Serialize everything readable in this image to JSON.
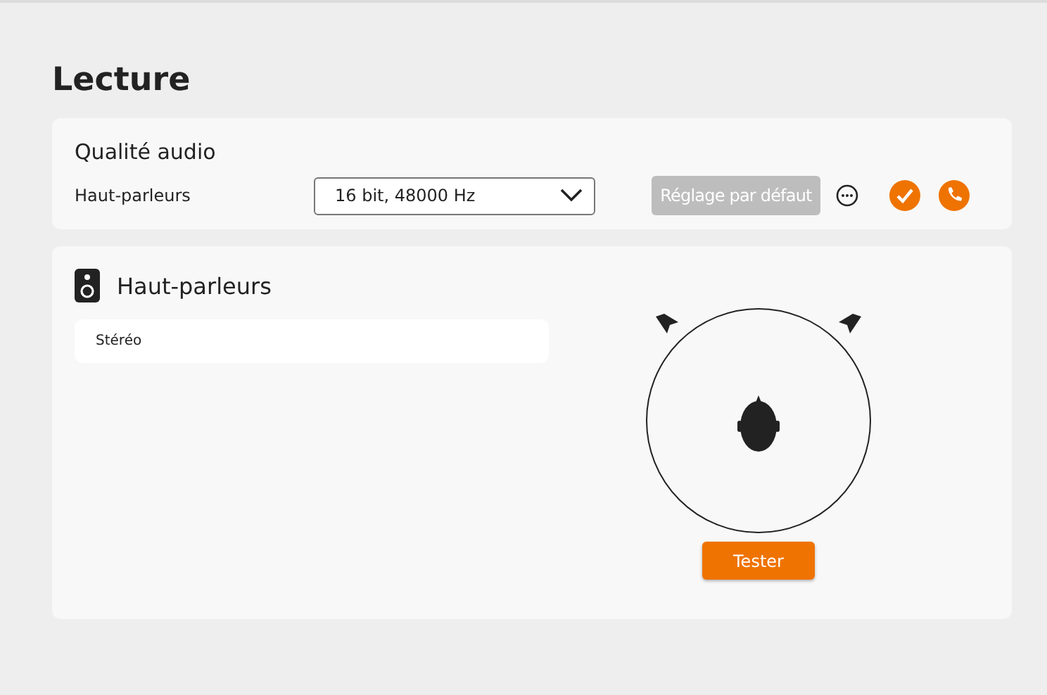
{
  "page": {
    "title": "Lecture"
  },
  "audio_quality": {
    "title": "Qualité audio",
    "device_label": "Haut-parleurs",
    "format": "16 bit, 48000 Hz",
    "default_button": {
      "label": "Réglage par défaut",
      "disabled": true
    }
  },
  "speakers": {
    "title": "Haut-parleurs",
    "configuration": "Stéréo",
    "test_button": "Tester"
  }
}
